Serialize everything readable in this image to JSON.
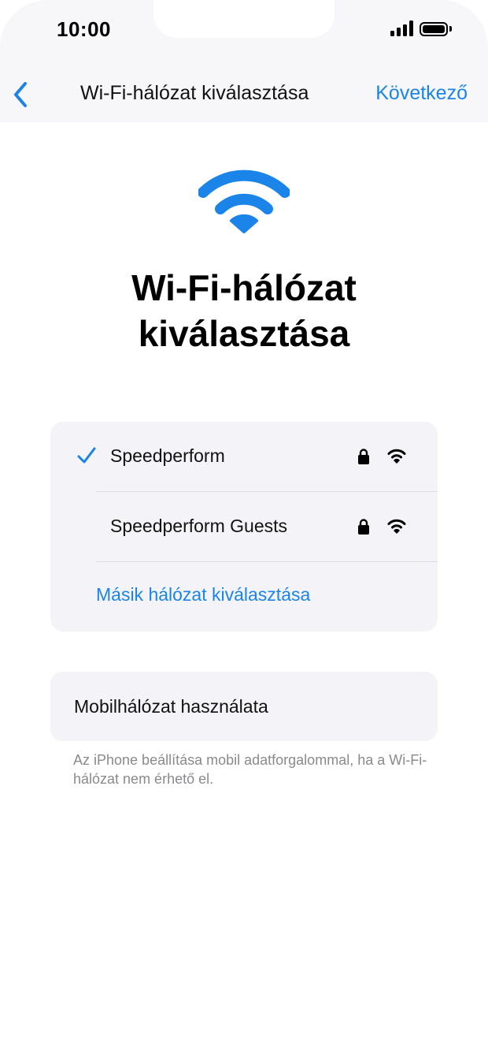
{
  "status_bar": {
    "time": "10:00",
    "signal_icon": "signal-bars-icon",
    "battery_icon": "battery-full-icon"
  },
  "nav": {
    "back_icon": "chevron-left-icon",
    "title": "Wi-Fi-hálózat kiválasztása",
    "next_label": "Következő"
  },
  "hero": {
    "icon": "wifi-icon",
    "title": "Wi-Fi-hálózat kiválasztása"
  },
  "networks": [
    {
      "name": "Speedperform",
      "selected": true,
      "secured": true
    },
    {
      "name": "Speedperform Guests",
      "selected": false,
      "secured": true
    }
  ],
  "other_network_label": "Másik hálózat kiválasztása",
  "cellular": {
    "label": "Mobilhálózat használata",
    "footnote": "Az iPhone beállítása mobil adatforgalommal, ha a Wi-Fi-hálózat nem érhető el."
  },
  "colors": {
    "accent": "#1a84e8",
    "card_bg": "#f4f4f8",
    "secondary_text": "#8a8a8e"
  }
}
